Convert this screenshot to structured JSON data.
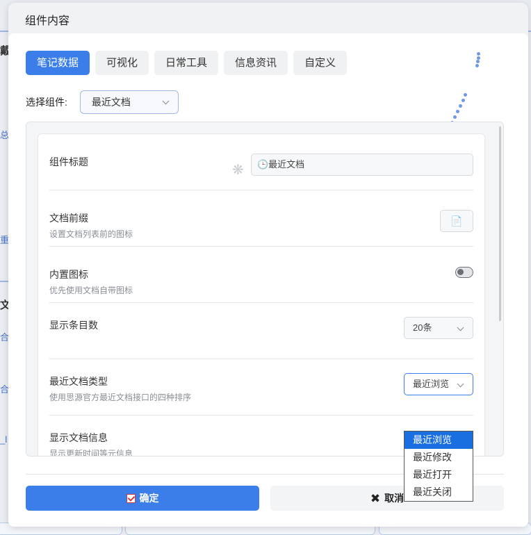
{
  "dialog": {
    "title": "组件内容",
    "tabs": [
      {
        "label": "笔记数据",
        "active": true
      },
      {
        "label": "可视化",
        "active": false
      },
      {
        "label": "日常工具",
        "active": false
      },
      {
        "label": "信息资讯",
        "active": false
      },
      {
        "label": "自定义",
        "active": false
      }
    ],
    "selector": {
      "label": "选择组件:",
      "value": "最近文档"
    },
    "settings": {
      "widget_title": {
        "title": "组件标题",
        "value": "🕒最近文档"
      },
      "doc_prefix": {
        "title": "文档前缀",
        "desc": "设置文档列表前的图标",
        "icon": "document-icon"
      },
      "builtin_icon": {
        "title": "内置图标",
        "desc": "优先使用文档自带图标",
        "enabled": false
      },
      "item_count": {
        "title": "显示条目数",
        "value": "20条"
      },
      "recent_type": {
        "title": "最近文档类型",
        "desc": "使用思源官方最近文档接口的四种排序",
        "value": "最近浏览"
      },
      "show_info": {
        "title": "显示文档信息",
        "desc": "显示更新时间等元信息"
      }
    },
    "dropdown_options": [
      {
        "label": "最近浏览",
        "selected": true
      },
      {
        "label": "最近修改",
        "selected": false
      },
      {
        "label": "最近打开",
        "selected": false
      },
      {
        "label": "最近关闭",
        "selected": false
      }
    ],
    "buttons": {
      "ok": "确定",
      "cancel": "取消"
    }
  },
  "background": {
    "fragments": [
      "戴",
      "总结",
      "重",
      "文",
      "合",
      "合",
      "_l"
    ]
  },
  "colors": {
    "accent": "#3b7de9",
    "selected_option": "#1a6fe0",
    "check": "#d23b3b"
  }
}
